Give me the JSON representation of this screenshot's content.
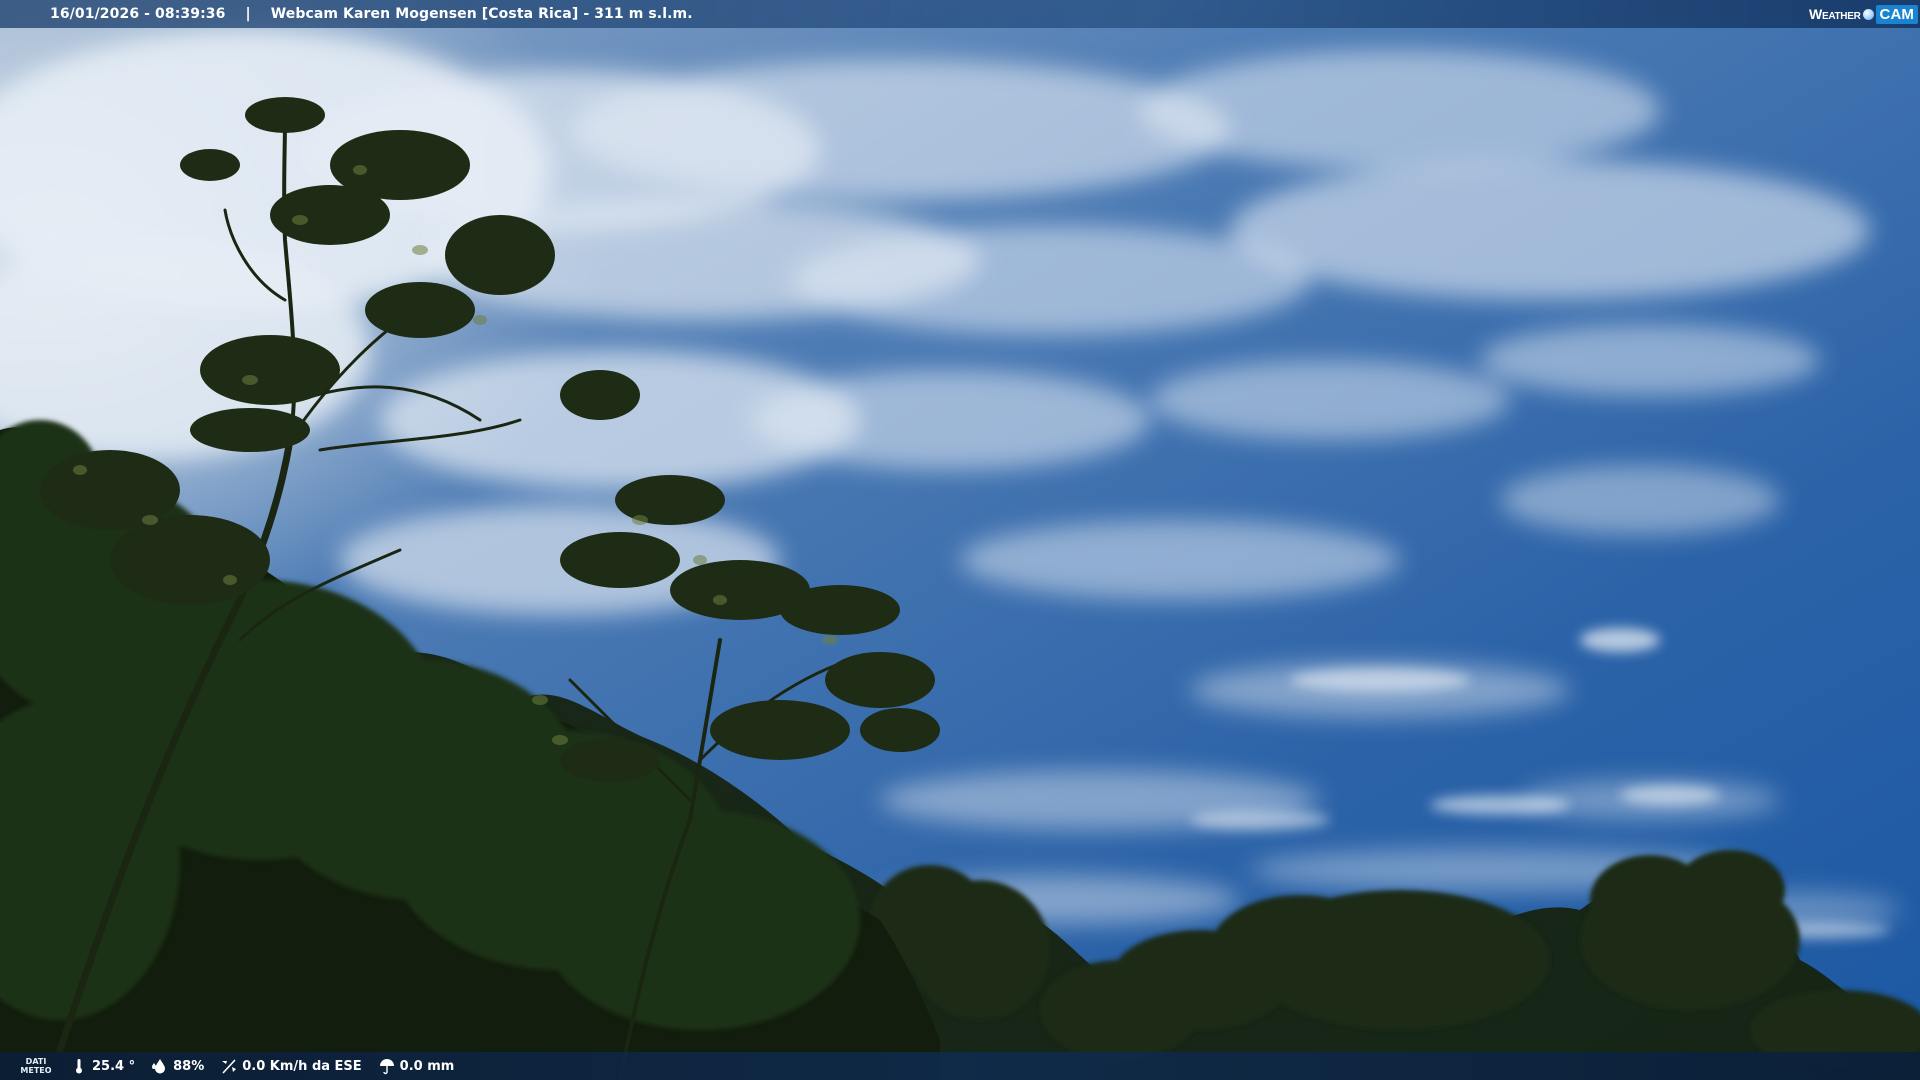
{
  "header": {
    "datetime": "16/01/2026 - 08:39:36",
    "title": "Webcam Karen Mogensen [Costa Rica]  - 311 m s.l.m."
  },
  "brand": {
    "part1": "Weather",
    "part2": "CAM"
  },
  "weather": {
    "label_line1": "DATI",
    "label_line2": "METEO",
    "temperature": "25.4 °",
    "humidity": "88%",
    "wind": "0.0 Km/h da ESE",
    "rain": "0.0 mm"
  },
  "icons": {
    "temperature": "thermometer-icon",
    "humidity": "humidity-drop-icon",
    "wind": "wind-vane-icon",
    "rain": "rain-umbrella-icon",
    "brand_dot": "globe-dot-icon"
  },
  "colors": {
    "sky_top": "#3f70ad",
    "sky_bottom": "#1f5aa6",
    "clouds": "#e8eef5",
    "foliage": "#14200f",
    "brand_accent": "#1b84d1"
  }
}
